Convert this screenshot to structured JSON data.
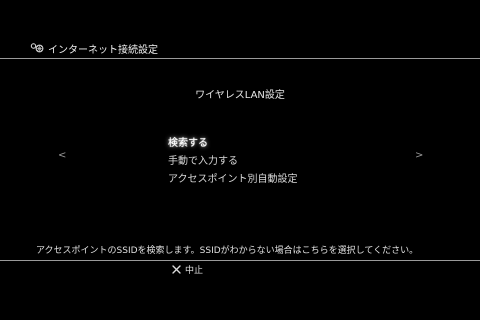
{
  "header": {
    "icon": "network-settings-icon",
    "title": "インターネット接続設定"
  },
  "section_title": "ワイヤレスLAN設定",
  "menu": {
    "items": [
      {
        "label": "検索する",
        "selected": true
      },
      {
        "label": "手動で入力する",
        "selected": false
      },
      {
        "label": "アクセスポイント別自動設定",
        "selected": false
      }
    ],
    "left_arrow": "<",
    "right_arrow": ">"
  },
  "help_text": "アクセスポイントのSSIDを検索します。SSIDがわからない場合はこちらを選択してください。",
  "footer": {
    "cancel_icon": "cross-button-icon",
    "cancel_label": "中止"
  },
  "colors": {
    "background": "#000000",
    "text": "#e8e8e8",
    "rule": "#9a9a9a"
  }
}
